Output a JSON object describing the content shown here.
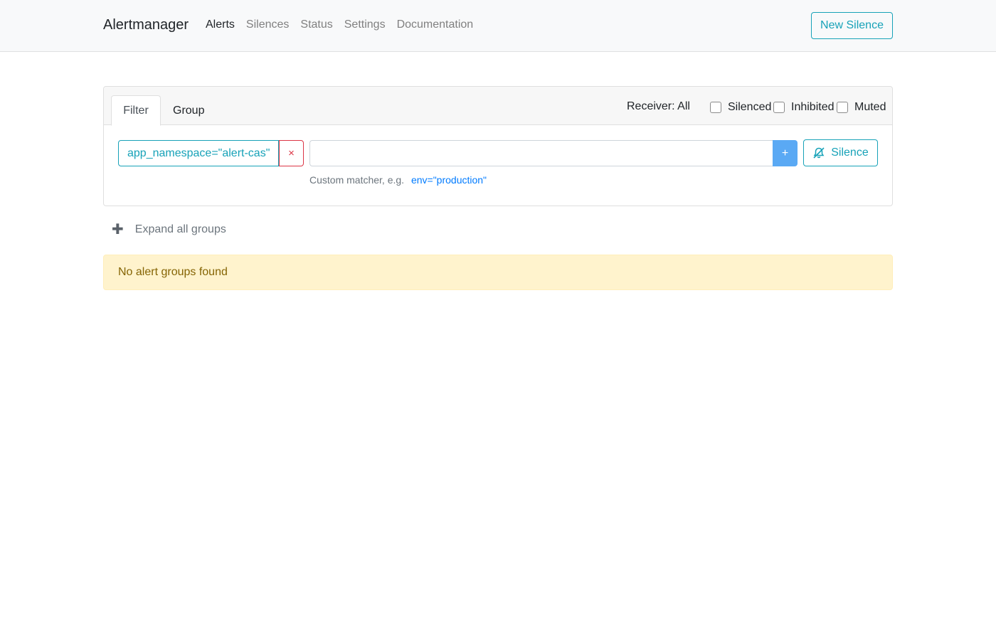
{
  "navbar": {
    "brand": "Alertmanager",
    "links": [
      {
        "label": "Alerts",
        "active": true
      },
      {
        "label": "Silences",
        "active": false
      },
      {
        "label": "Status",
        "active": false
      },
      {
        "label": "Settings",
        "active": false
      },
      {
        "label": "Documentation",
        "active": false
      }
    ],
    "new_silence_label": "New Silence"
  },
  "filter_card": {
    "tabs": {
      "filter": "Filter",
      "group": "Group"
    },
    "active_tab": "Filter",
    "receiver_label": "Receiver: All",
    "checkboxes": {
      "silenced": {
        "label": "Silenced",
        "checked": false
      },
      "inhibited": {
        "label": "Inhibited",
        "checked": false
      },
      "muted": {
        "label": "Muted",
        "checked": false
      }
    },
    "matchers": [
      {
        "text": "app_namespace=\"alert-cas\"",
        "remove_label": "×"
      }
    ],
    "input": {
      "value": "",
      "placeholder": ""
    },
    "add_button_label": "+",
    "silence_button_label": "Silence",
    "hint_text": "Custom matcher, e.g.",
    "hint_example": "env=\"production\""
  },
  "expand": {
    "icon": "plus-icon",
    "label": "Expand all groups"
  },
  "alert": {
    "message": "No alert groups found"
  },
  "colors": {
    "accent": "#17a2b8",
    "danger": "#dc3545",
    "primary": "#007bff",
    "warning_bg": "#fff3cd",
    "warning_text": "#856404"
  }
}
